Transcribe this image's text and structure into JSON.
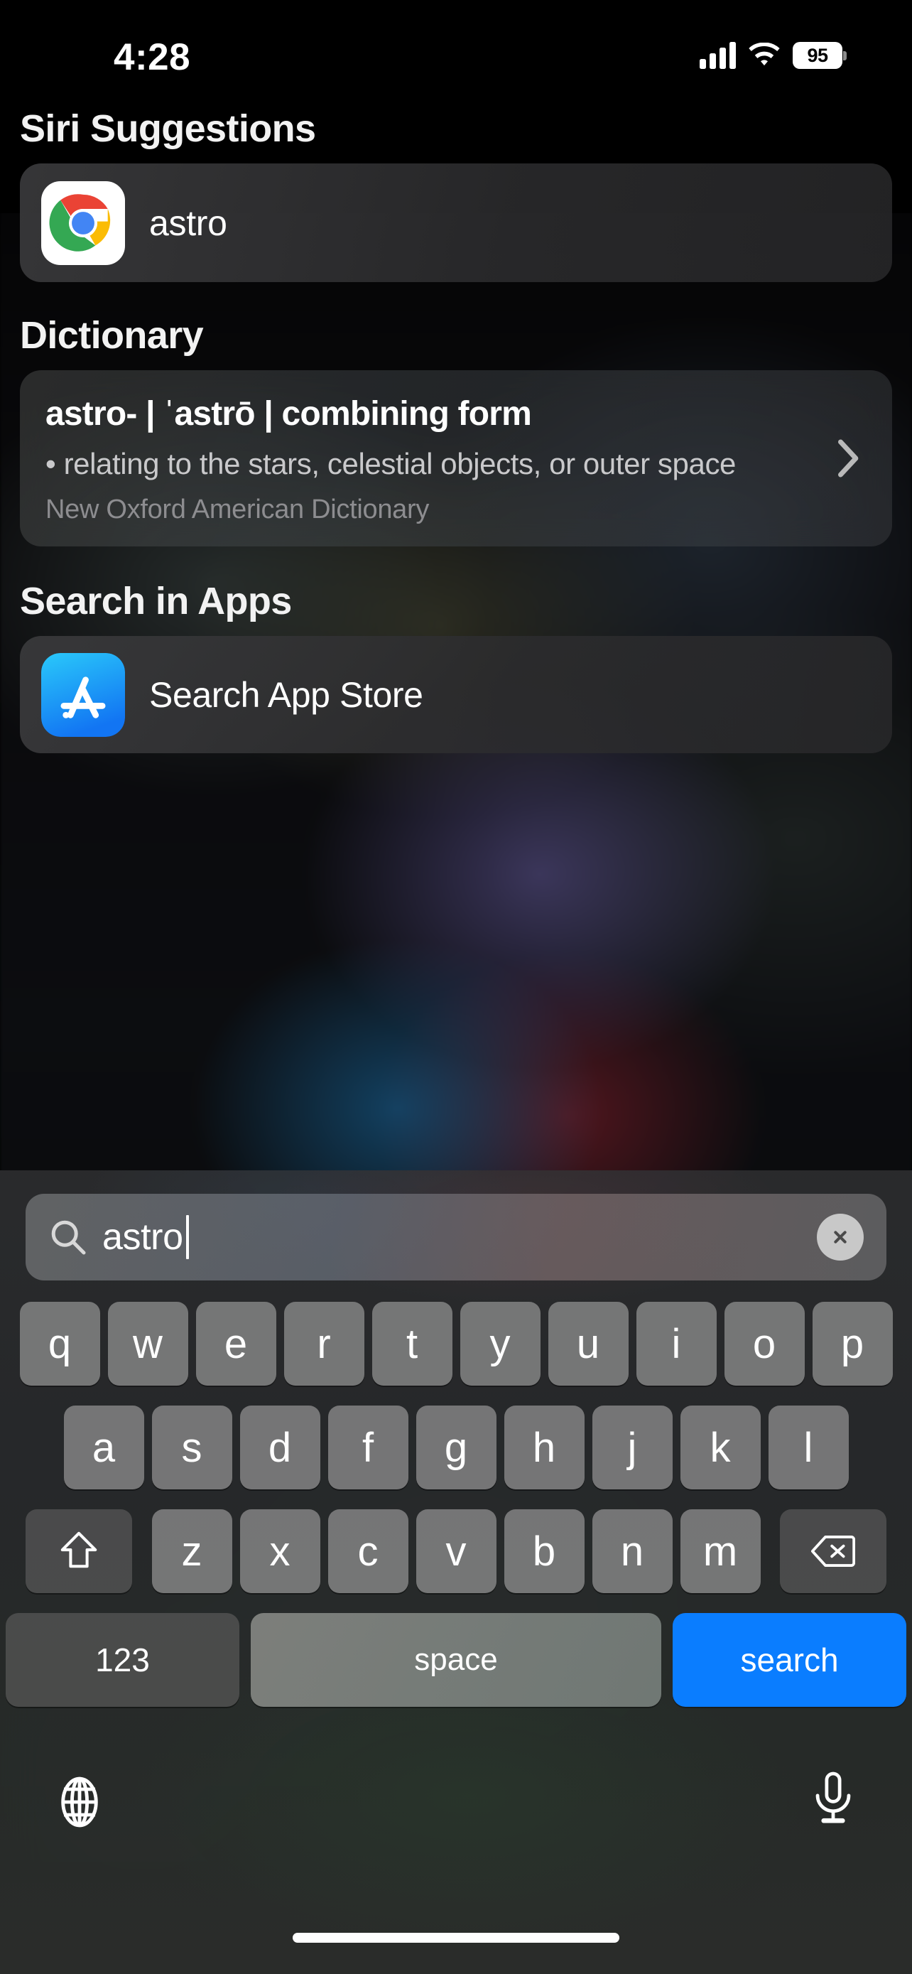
{
  "status_bar": {
    "time": "4:28",
    "battery_percent": "95",
    "cellular_icon": "cellular-bars-icon",
    "wifi_icon": "wifi-icon",
    "battery_icon": "battery-icon"
  },
  "sections": {
    "siri": {
      "title": "Siri Suggestions",
      "item": {
        "label": "astro",
        "icon": "chrome-app-icon"
      }
    },
    "dictionary": {
      "title": "Dictionary",
      "entry": {
        "headword": "astro-  |  ˈastrō  |  combining form",
        "definition": "• relating to the stars, celestial objects, or outer space",
        "source": "New Oxford American Dictionary",
        "chevron_icon": "chevron-right-icon"
      }
    },
    "search_in_apps": {
      "title": "Search in Apps",
      "item": {
        "label": "Search App Store",
        "icon": "app-store-icon"
      }
    }
  },
  "search": {
    "value": "astro",
    "placeholder": "Search",
    "search_icon": "search-magnifier-icon",
    "clear_icon": "clear-circle-x-icon"
  },
  "keyboard": {
    "row1": [
      "q",
      "w",
      "e",
      "r",
      "t",
      "y",
      "u",
      "i",
      "o",
      "p"
    ],
    "row2": [
      "a",
      "s",
      "d",
      "f",
      "g",
      "h",
      "j",
      "k",
      "l"
    ],
    "row3": [
      "z",
      "x",
      "c",
      "v",
      "b",
      "n",
      "m"
    ],
    "shift_icon": "shift-arrow-icon",
    "delete_icon": "backspace-delete-icon",
    "numbers_label": "123",
    "space_label": "space",
    "return_label": "search",
    "globe_icon": "globe-language-icon",
    "mic_icon": "microphone-icon",
    "return_key_color": "#0a7dff"
  },
  "colors": {
    "accent_blue": "#0a7dff",
    "key_light": "#7c7c7c",
    "key_dark": "#4e4e4e",
    "background": "#000000"
  }
}
